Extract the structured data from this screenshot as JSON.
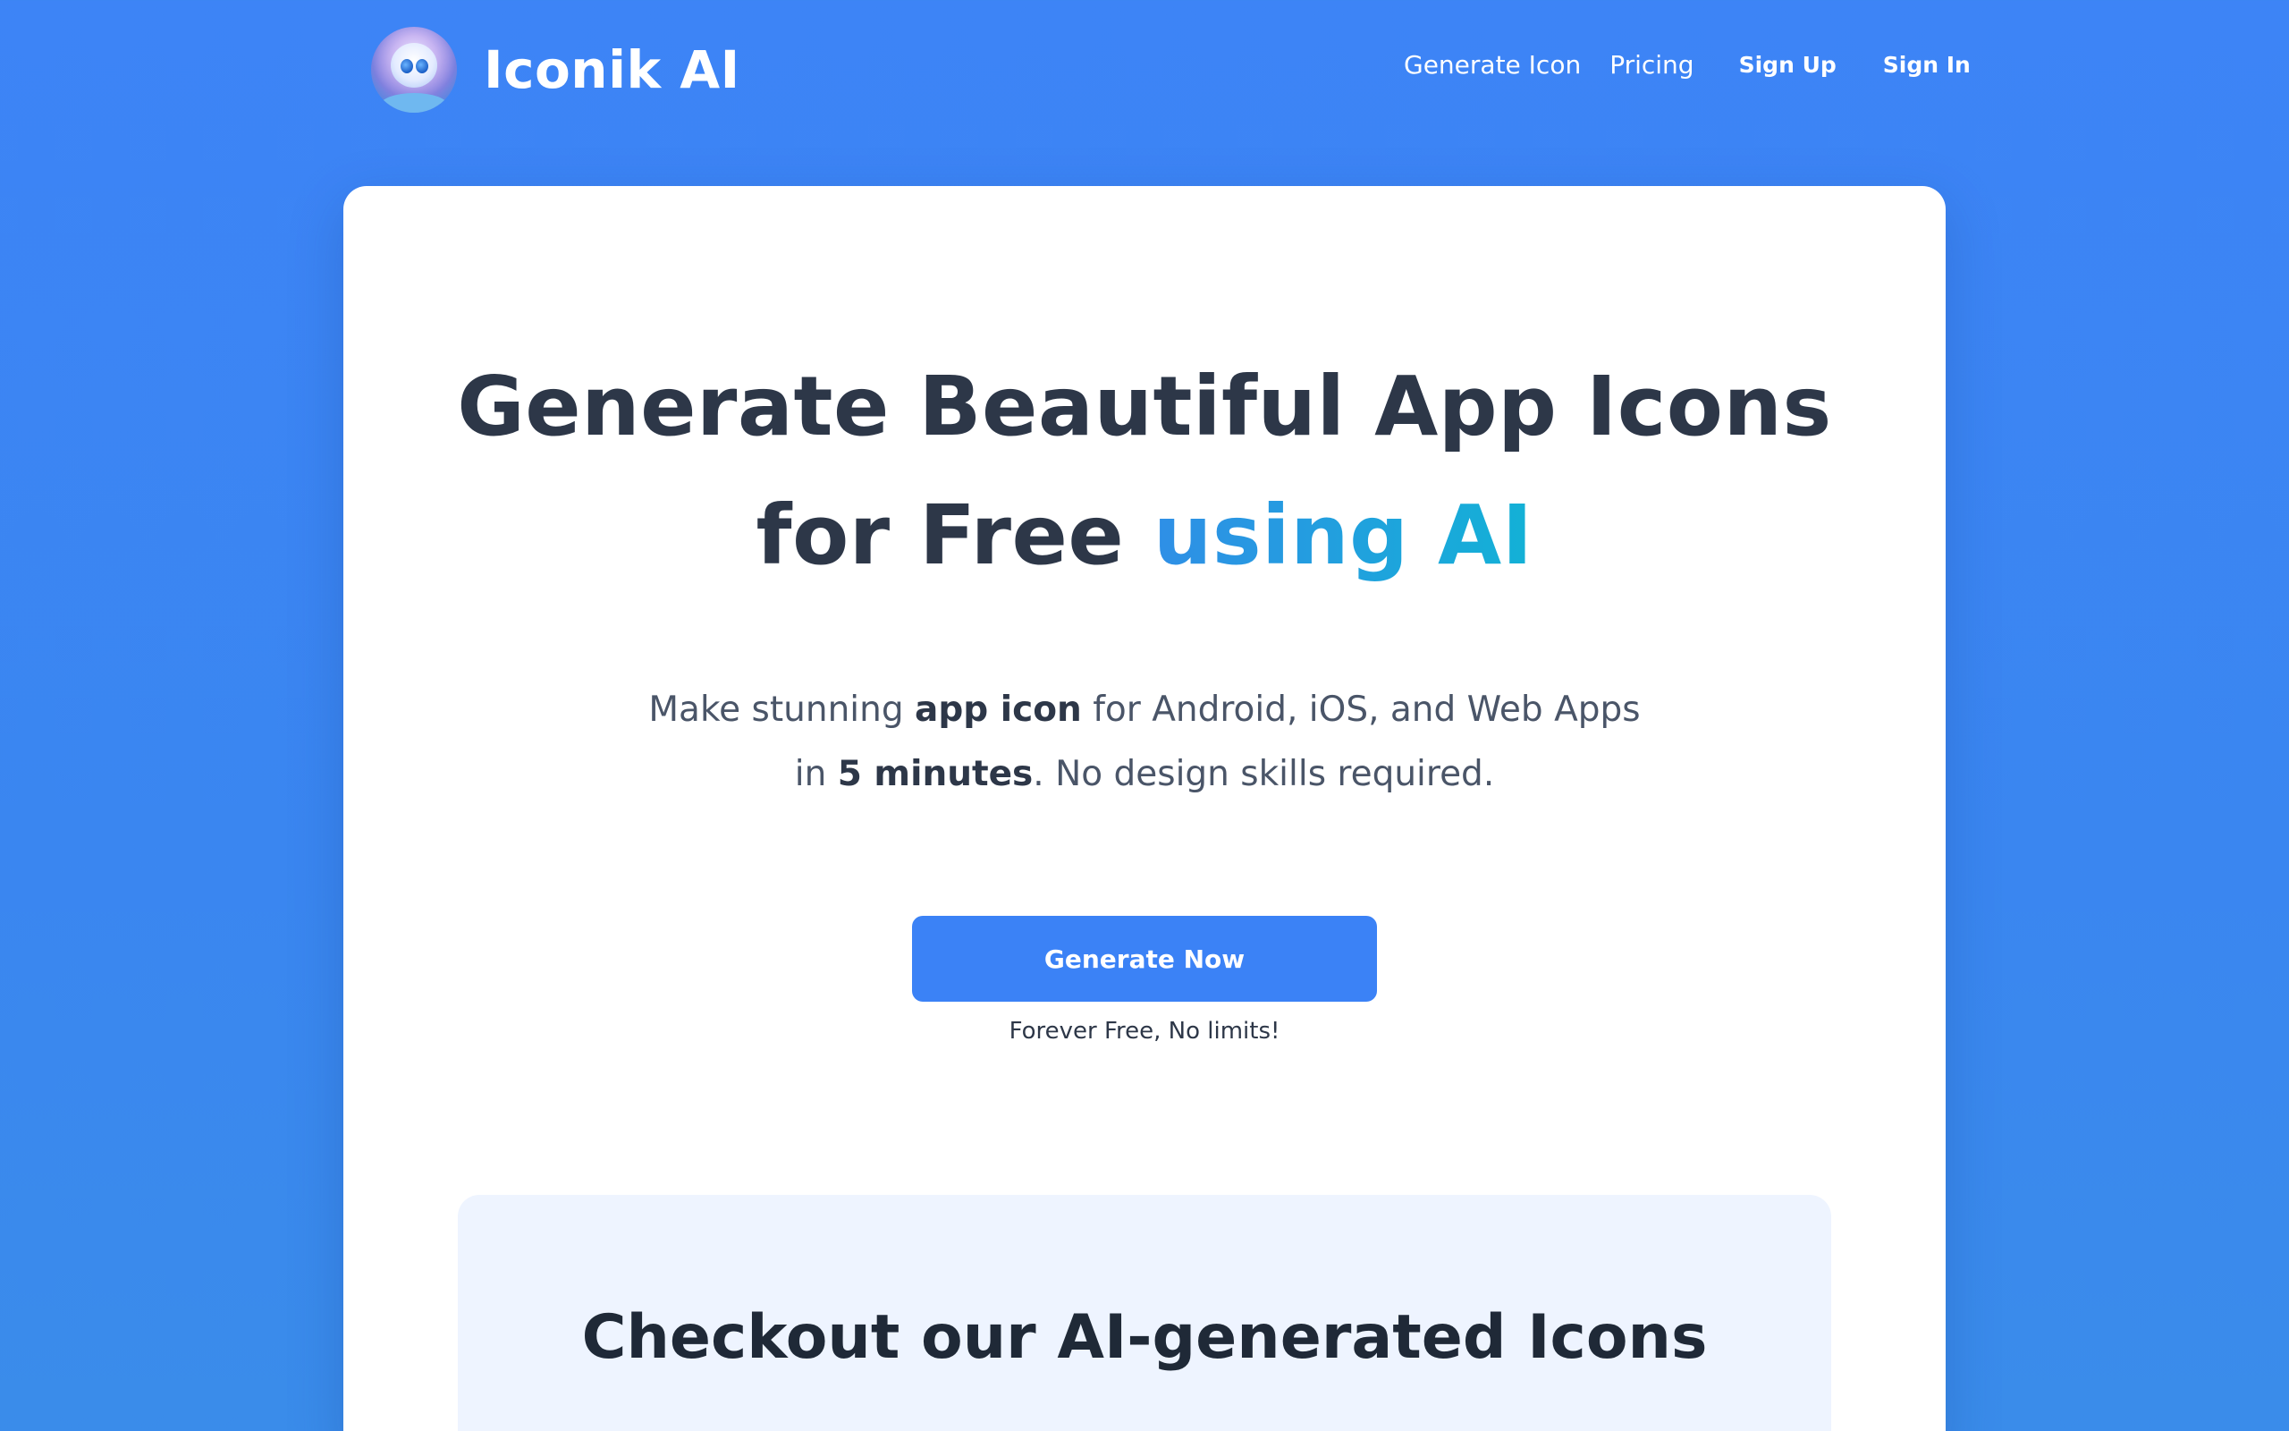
{
  "header": {
    "brand_name": "Iconik AI",
    "logo_icon": "robot-face-logo",
    "nav": {
      "generate_icon": "Generate Icon",
      "pricing": "Pricing",
      "sign_up": "Sign Up",
      "sign_in": "Sign In"
    }
  },
  "hero": {
    "title_line1": "Generate Beautiful App Icons",
    "title_line2_plain": "for Free",
    "title_line2_accent": "using AI",
    "subtitle": {
      "p1": "Make stunning ",
      "b1": "app icon",
      "p2": " for Android, iOS, and Web Apps",
      "p3": "in ",
      "b2": "5 minutes",
      "p4": ". No design skills required."
    },
    "cta_label": "Generate Now",
    "cta_note": "Forever Free, No limits!"
  },
  "gallery": {
    "title": "Checkout our AI-generated Icons"
  },
  "colors": {
    "background": "#3d84f6",
    "primary_button": "#3b82f6",
    "heading": "#2d3748",
    "accent_gradient_start": "#2f8fe6",
    "accent_gradient_end": "#13b1d6",
    "gallery_background": "#eef4ff"
  }
}
